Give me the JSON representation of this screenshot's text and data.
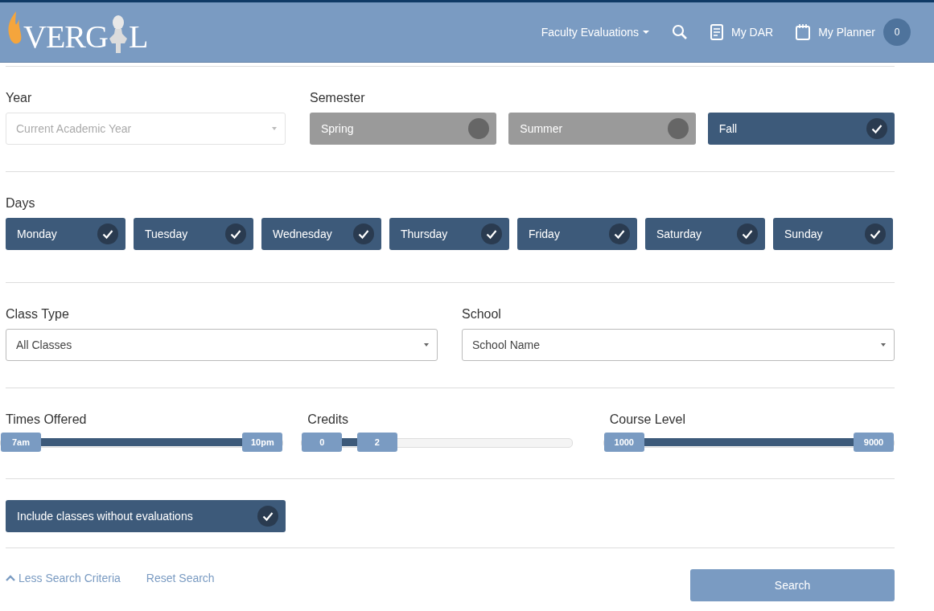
{
  "header": {
    "logo": {
      "left": "VERG",
      "right": "L"
    },
    "nav": [
      {
        "kind": "dropdown",
        "label": "Faculty Evaluations"
      },
      {
        "kind": "search"
      },
      {
        "kind": "document",
        "label": "My DAR"
      },
      {
        "kind": "calendar",
        "label": "My Planner",
        "badge": "0"
      }
    ]
  },
  "year": {
    "label": "Year",
    "placeholder": "Current Academic Year"
  },
  "semester": {
    "label": "Semester",
    "options": [
      {
        "label": "Spring",
        "selected": false
      },
      {
        "label": "Summer",
        "selected": false
      },
      {
        "label": "Fall",
        "selected": true
      }
    ]
  },
  "days": {
    "label": "Days",
    "options": [
      {
        "label": "Monday",
        "selected": true
      },
      {
        "label": "Tuesday",
        "selected": true
      },
      {
        "label": "Wednesday",
        "selected": true
      },
      {
        "label": "Thursday",
        "selected": true
      },
      {
        "label": "Friday",
        "selected": true
      },
      {
        "label": "Saturday",
        "selected": true
      },
      {
        "label": "Sunday",
        "selected": true
      }
    ]
  },
  "class_type": {
    "label": "Class Type",
    "value": "All Classes"
  },
  "school": {
    "label": "School",
    "value": "School Name"
  },
  "sliders": [
    {
      "label": "Times Offered",
      "handles": [
        {
          "label": "7am",
          "level": 0
        },
        {
          "label": "10pm",
          "level": 1
        }
      ]
    },
    {
      "label": "Credits",
      "handles": [
        {
          "label": "0",
          "level": 0
        },
        {
          "label": "2",
          "level": 0.24
        }
      ]
    },
    {
      "label": "Course Level",
      "handles": [
        {
          "label": "1000",
          "level": 0
        },
        {
          "label": "9000",
          "level": 1
        }
      ]
    }
  ],
  "include_toggle": {
    "label": "Include classes without evaluations",
    "checked": true
  },
  "footer": {
    "less_link": "Less Search Criteria",
    "reset_link": "Reset Search",
    "search_button": "Search"
  }
}
